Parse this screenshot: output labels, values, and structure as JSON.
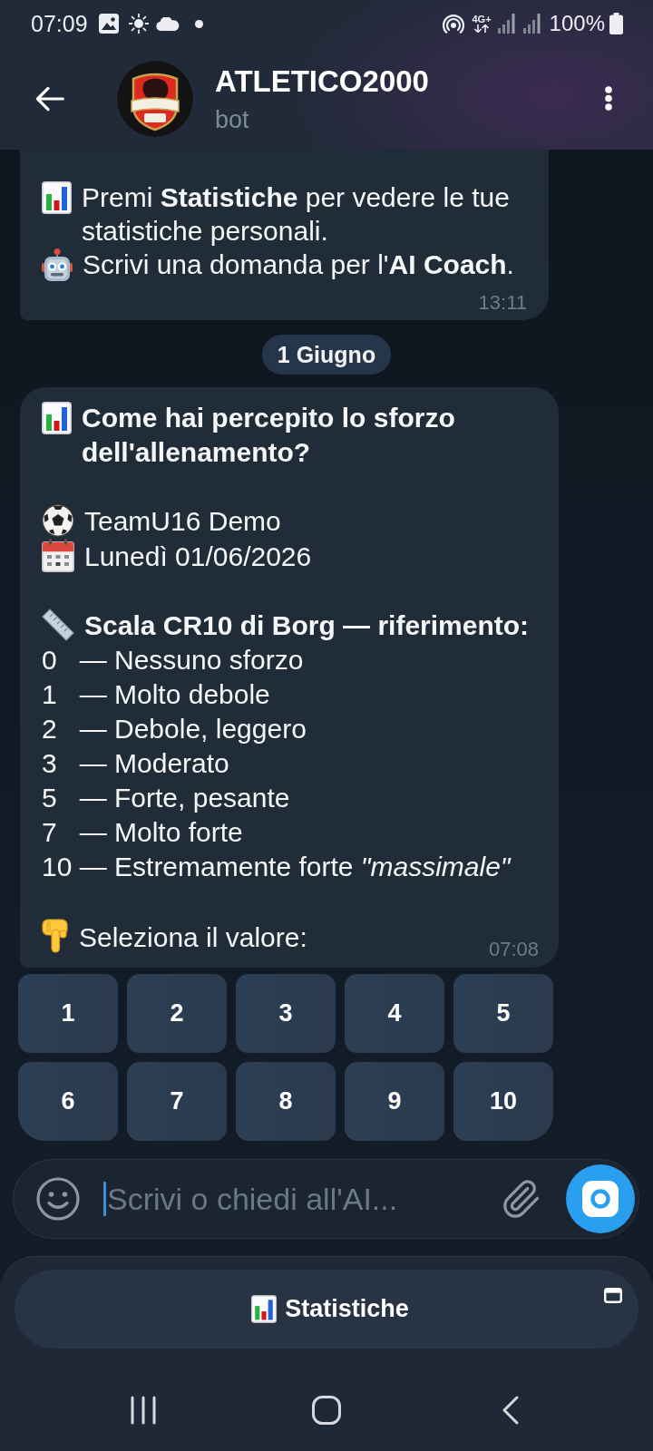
{
  "status_bar": {
    "time": "07:09",
    "network": "4G+",
    "battery": "100%"
  },
  "header": {
    "title": "ATLETICO2000",
    "subtitle": "bot"
  },
  "messages": [
    {
      "kind": "hints",
      "hints": [
        {
          "kind": "stats",
          "text": "Premi **Statistiche** per vedere le tue statistiche personali."
        },
        {
          "kind": "coach",
          "text": "Scrivi una domanda per l'**AI Coach**."
        }
      ],
      "time": "13:11"
    },
    {
      "kind": "date",
      "label": "1 Giugno"
    },
    {
      "kind": "survey",
      "title": "Come hai percepito lo sforzo dell'allenamento?",
      "team": "TeamU16 Demo",
      "date": "Lunedì 01/06/2026",
      "scale_title": "Scala CR10 di Borg — riferimento:",
      "scale": [
        "0   — Nessuno sforzo",
        "1   — Molto debole",
        "2   — Debole, leggero",
        "3   — Moderato",
        "5   — Forte, pesante",
        "7   — Molto forte",
        "10 — Estremamente forte *\"massimale\"*"
      ],
      "prompt": "Seleziona il valore:",
      "time": "07:08"
    }
  ],
  "inline_keyboard": [
    [
      "1",
      "2",
      "3",
      "4",
      "5"
    ],
    [
      "6",
      "7",
      "8",
      "9",
      "10"
    ]
  ],
  "composer": {
    "placeholder": "Scrivi o chiedi all'AI..."
  },
  "reply_keyboard": [
    {
      "label": "Statistiche"
    }
  ]
}
